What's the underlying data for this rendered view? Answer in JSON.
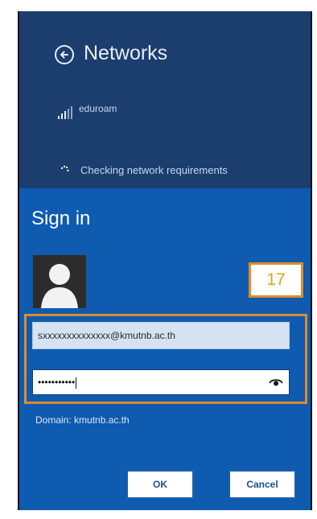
{
  "networks": {
    "title": "Networks",
    "network_name": "eduroam",
    "status": "Checking network requirements"
  },
  "signin": {
    "title": "Sign in",
    "step_badge": "17",
    "username_value": "sxxxxxxxxxxxxxx@kmutnb.ac.th",
    "password_value": "•••••••••••",
    "domain_text": "Domain: kmutnb.ac.th",
    "ok_label": "OK",
    "cancel_label": "Cancel"
  },
  "icons": {
    "back": "back-arrow-icon",
    "signal": "signal-strength-icon",
    "progress": "progress-dots-icon",
    "avatar": "user-avatar-icon",
    "reveal": "eye-icon"
  },
  "colors": {
    "panel_blue": "#0e5bb0",
    "header_navy": "#1b3e6f",
    "highlight_orange": "#e08a2c"
  }
}
